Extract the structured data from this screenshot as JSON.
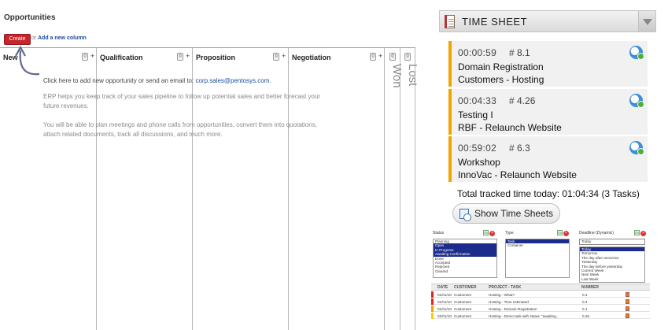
{
  "opportunities": {
    "title": "Opportunities",
    "create_label": "Create",
    "or_text": "or",
    "add_column_label": "Add a new column",
    "columns": [
      {
        "label": "New",
        "count": "0"
      },
      {
        "label": "Qualification",
        "count": "0"
      },
      {
        "label": "Proposition",
        "count": "0"
      },
      {
        "label": "Negotiation",
        "count": "0"
      },
      {
        "label": "Won",
        "count": "0"
      },
      {
        "label": "Lost",
        "count": "0"
      }
    ],
    "plus": "+",
    "help_line1": "Click here to add new opportunity or send an email to: ",
    "help_email": "corp.sales@pentosys.com.",
    "help_line2": "ERP helps you keep track of your sales pipeline to follow up potential sales and better forecast your future revenues.",
    "help_line3": "You will be able to plan meetings and phone calls from opportunities, convert them into quotations, attach related documents, track all discussions, and much more."
  },
  "timesheet": {
    "title": "TIME SHEET",
    "entries": [
      {
        "time": "00:00:59",
        "number": "# 8.1",
        "task": "Domain Registration",
        "project": "Customers - Hosting"
      },
      {
        "time": "00:04:33",
        "number": "# 4.26",
        "task": "Testing I",
        "project": "RBF - Relaunch Website"
      },
      {
        "time": "00:59:02",
        "number": "# 6.3",
        "task": "Workshop",
        "project": "InnoVac - Relaunch Website"
      }
    ],
    "total": "Total tracked time today: 01:04:34 (3 Tasks)",
    "show_button": "Show Time Sheets",
    "accent_color": "#f0a500"
  },
  "mini_report": {
    "status_filter": {
      "label": "Status",
      "options": [
        {
          "text": "Planning",
          "selected": false
        },
        {
          "text": "Open",
          "selected": true
        },
        {
          "text": "In Progress",
          "selected": true
        },
        {
          "text": "Awaiting Confirmation",
          "selected": true
        },
        {
          "text": "Done",
          "selected": false
        },
        {
          "text": "Accepted",
          "selected": false
        },
        {
          "text": "Rejected",
          "selected": false
        },
        {
          "text": "Cleared",
          "selected": false
        }
      ]
    },
    "type_filter": {
      "label": "Type",
      "options": [
        {
          "text": "Task",
          "selected": true
        },
        {
          "text": "Container",
          "selected": false
        }
      ]
    },
    "deadline_filter": {
      "label": "Deadline (Dynamic)",
      "selected_value": "Today",
      "options": [
        {
          "text": "Today",
          "selected": true
        },
        {
          "text": "Tomorrow",
          "selected": false
        },
        {
          "text": "The day after tomorrow",
          "selected": false
        },
        {
          "text": "Yesterday",
          "selected": false
        },
        {
          "text": "The day before yesterday",
          "selected": false
        },
        {
          "text": "Current Week",
          "selected": false
        },
        {
          "text": "Next Week",
          "selected": false
        },
        {
          "text": "Last Week",
          "selected": false
        }
      ]
    },
    "ok_label": "Ok",
    "columns": [
      "DATE",
      "CUSTOMER",
      "PROJECT - TASK",
      "NUMBER"
    ],
    "rows": [
      {
        "date": "01/01/10",
        "customer": "Customers",
        "task": "Hosting - What?",
        "number": "0.3",
        "flag": "#d9261c"
      },
      {
        "date": "01/01/10",
        "customer": "Customers",
        "task": "Hosting - Time estimated",
        "number": "0.4",
        "flag": "#d9261c"
      },
      {
        "date": "01/01/10",
        "customer": "Customers",
        "task": "Hosting - Domain-Registration",
        "number": "0.1",
        "flag": "#f0a500"
      },
      {
        "date": "02/01/10",
        "customer": "Customers",
        "task": "Hosting - Demo task with status: \"awaiting...",
        "number": "0.26",
        "flag": "#f0d000"
      }
    ]
  }
}
